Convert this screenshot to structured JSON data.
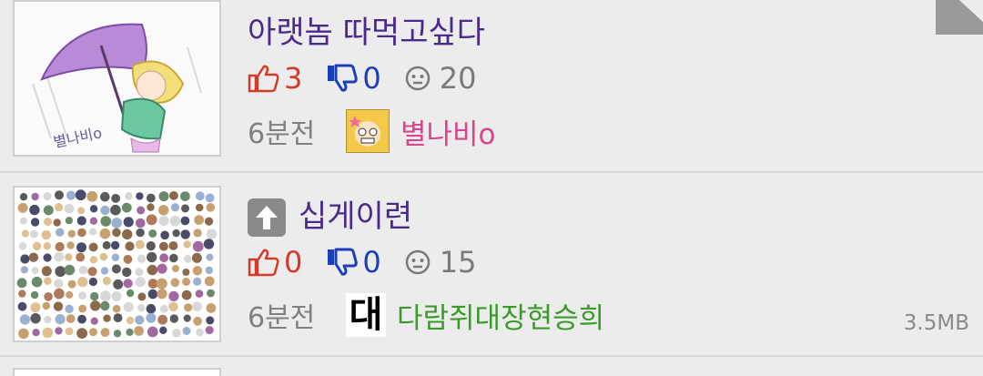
{
  "posts": [
    {
      "title": "아랫놈 따먹고싶다",
      "upvotes": "3",
      "downvotes": "0",
      "comments": "20",
      "time": "6분전",
      "user": "별나비o",
      "thumbnail": "purple-umbrella-drawing",
      "thumb_caption": "별나비o",
      "avatar": "star-character-avatar"
    },
    {
      "title": "십게이련",
      "upvotes": "0",
      "downvotes": "0",
      "comments": "15",
      "time": "6분전",
      "user": "다람쥐대장현승희",
      "thumbnail": "many-faces-collage",
      "avatar_glyph": "대",
      "filesize": "3.5MB",
      "title_icon": "up-arrow-icon"
    }
  ],
  "colors": {
    "title": "#4a2a8a",
    "up": "#d43a2a",
    "down": "#1a3fb8",
    "user_pink": "#d9458a",
    "user_green": "#3a9a2a"
  }
}
